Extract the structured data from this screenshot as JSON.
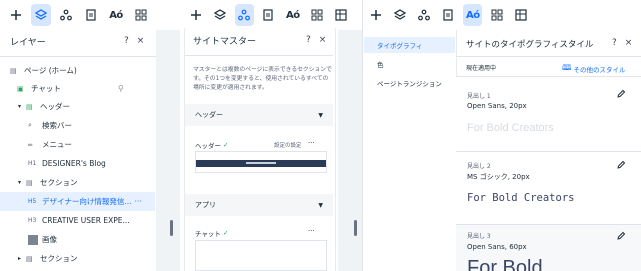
{
  "toolbar_icons": [
    "add-icon",
    "layers-icon",
    "site-master-icon",
    "pages-icon",
    "typography-icon",
    "apps-grid-icon",
    "table-icon"
  ],
  "toolbar_typography_text": "Aó",
  "layers_panel": {
    "title": "レイヤー",
    "help": "?",
    "close": "×",
    "rows": [
      {
        "label": "ページ (ホーム)",
        "prefix": "",
        "icon": "▤"
      },
      {
        "label": "チャット",
        "prefix": "",
        "icon": "▣"
      },
      {
        "label": "ヘッダー",
        "prefix": "▾",
        "icon": "▤"
      },
      {
        "label": "検索バー",
        "prefix": "",
        "icon": "⌕"
      },
      {
        "label": "メニュー",
        "prefix": "",
        "icon": "═"
      },
      {
        "label": "DESIGNER's Blog",
        "prefix": "",
        "icon": "H1"
      },
      {
        "label": "セクション",
        "prefix": "▾",
        "icon": "▤"
      },
      {
        "label": "デザイナー向け情報発信...",
        "prefix": "",
        "icon": "H5",
        "more": "···"
      },
      {
        "label": "CREATIVE USER EXPE...",
        "prefix": "",
        "icon": "H3"
      },
      {
        "label": "画像",
        "prefix": "",
        "icon": "▦"
      },
      {
        "label": "セクション",
        "prefix": "▸",
        "icon": "▤"
      }
    ]
  },
  "site_master": {
    "title": "サイトマスター",
    "help": "?",
    "close": "×",
    "description": "マスターとは複数のページに表示できるセクションです。その1つを変更すると、使用されているすべての場所に変更が適用されます。",
    "header_section": "ヘッダー",
    "header_item": "ヘッダー",
    "header_check": "✓",
    "header_settings": "設定の設定",
    "more": "···",
    "apps_section": "アプリ",
    "chat_item": "チャット",
    "chat_check": "✓"
  },
  "typography_nav": {
    "items": [
      {
        "label": "タイポグラフィ"
      },
      {
        "label": "色"
      },
      {
        "label": "ページトランジション"
      }
    ]
  },
  "typography_panel": {
    "title": "サイトのタイポグラフィスタイル",
    "help": "?",
    "close": "×",
    "current_label": "現在適用中",
    "other_styles_link": "その他のスタイル",
    "cards": [
      {
        "label": "見出し 1",
        "spec": "Open Sans, 20px",
        "preview": "For Bold Creators"
      },
      {
        "label": "見出し 2",
        "spec": "MS ゴシック, 20px",
        "preview": "For Bold Creators"
      },
      {
        "label": "見出し 3",
        "spec": "Open Sans, 60px",
        "preview": "For Bold"
      }
    ]
  },
  "colors": {
    "accent": "#116dff",
    "selected_bg": "#e7f0ff",
    "green": "#25a55f"
  }
}
